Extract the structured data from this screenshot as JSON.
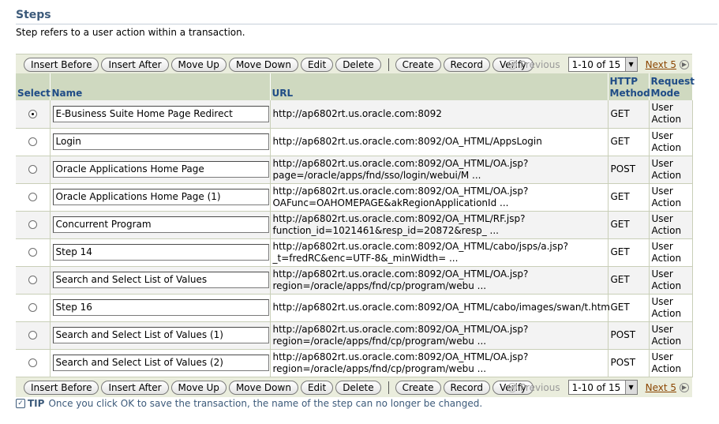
{
  "section": {
    "title": "Steps",
    "description": "Step refers to a user action within a transaction."
  },
  "toolbar": {
    "insert_before": "Insert Before",
    "insert_after": "Insert After",
    "move_up": "Move Up",
    "move_down": "Move Down",
    "edit": "Edit",
    "delete": "Delete",
    "create": "Create",
    "record": "Record",
    "verify": "Verify"
  },
  "pagination": {
    "previous": "Previous",
    "range": "1-10 of 15",
    "next": "Next 5"
  },
  "table": {
    "headers": {
      "select": "Select",
      "name": "Name",
      "url": "URL",
      "http_method": "HTTP Method",
      "request_mode": "Request Mode"
    },
    "rows": [
      {
        "name": "E-Business Suite Home Page Redirect",
        "url": "http://ap6802rt.us.oracle.com:8092",
        "method": "GET",
        "mode": "User Action"
      },
      {
        "name": "Login",
        "url": "http://ap6802rt.us.oracle.com:8092/OA_HTML/AppsLogin",
        "method": "GET",
        "mode": "User Action"
      },
      {
        "name": "Oracle Applications Home Page",
        "url": "http://ap6802rt.us.oracle.com:8092/OA_HTML/OA.jsp?\npage=/oracle/apps/fnd/sso/login/webui/M ...",
        "method": "POST",
        "mode": "User Action"
      },
      {
        "name": "Oracle Applications Home Page (1)",
        "url": "http://ap6802rt.us.oracle.com:8092/OA_HTML/OA.jsp?\nOAFunc=OAHOMEPAGE&akRegionApplicationId ...",
        "method": "GET",
        "mode": "User Action"
      },
      {
        "name": "Concurrent Program",
        "url": "http://ap6802rt.us.oracle.com:8092/OA_HTML/RF.jsp?\nfunction_id=1021461&resp_id=20872&resp_ ...",
        "method": "GET",
        "mode": "User Action"
      },
      {
        "name": "Step 14",
        "url": "http://ap6802rt.us.oracle.com:8092/OA_HTML/cabo/jsps/a.jsp?\n_t=fredRC&enc=UTF-8&_minWidth= ...",
        "method": "GET",
        "mode": "User Action"
      },
      {
        "name": "Search and Select List of Values",
        "url": "http://ap6802rt.us.oracle.com:8092/OA_HTML/OA.jsp?\nregion=/oracle/apps/fnd/cp/program/webu ...",
        "method": "GET",
        "mode": "User Action"
      },
      {
        "name": "Step 16",
        "url": "http://ap6802rt.us.oracle.com:8092/OA_HTML/cabo/images/swan/t.htm",
        "method": "GET",
        "mode": "User Action"
      },
      {
        "name": "Search and Select List of Values (1)",
        "url": "http://ap6802rt.us.oracle.com:8092/OA_HTML/OA.jsp?\nregion=/oracle/apps/fnd/cp/program/webu ...",
        "method": "POST",
        "mode": "User Action"
      },
      {
        "name": "Search and Select List of Values (2)",
        "url": "http://ap6802rt.us.oracle.com:8092/OA_HTML/OA.jsp?\nregion=/oracle/apps/fnd/cp/program/webu ...",
        "method": "POST",
        "mode": "User Action"
      }
    ]
  },
  "tip": {
    "label": "TIP",
    "text": "Once you click OK to save the transaction, the name of the step can no longer be changed."
  },
  "icons": {
    "previous": "previous-circle-icon",
    "next": "next-circle-icon",
    "dropdown": "chevron-down-icon",
    "tip": "checkmark-icon"
  },
  "colors": {
    "header_bg": "#cfd9c0",
    "header_text": "#1f4c86",
    "toolbar_bg": "#eaeddd",
    "title": "#3c5a7a",
    "next_link": "#8b4500"
  }
}
